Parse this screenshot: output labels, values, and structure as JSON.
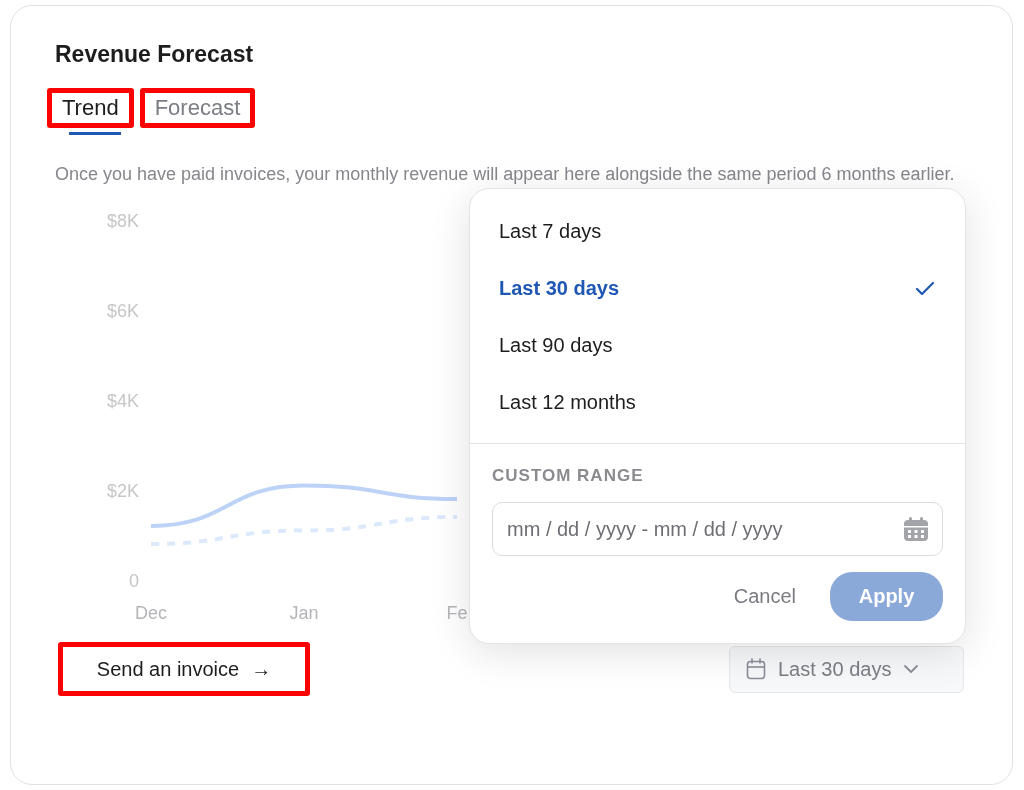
{
  "card": {
    "title": "Revenue Forecast"
  },
  "tabs": [
    {
      "label": "Trend",
      "selected": true,
      "highlighted": true
    },
    {
      "label": "Forecast",
      "selected": false,
      "highlighted": true
    }
  ],
  "description": "Once you have paid invoices, your monthly revenue will appear here alongside the same period 6 months earlier.",
  "chart": {
    "chart_data": {
      "type": "line",
      "categories": [
        "Dec",
        "Jan",
        "Fe"
      ],
      "yticks": [
        {
          "value": 0,
          "label": "0"
        },
        {
          "value": 2000,
          "label": "$2K"
        },
        {
          "value": 4000,
          "label": "$4K"
        },
        {
          "value": 6000,
          "label": "$6K"
        },
        {
          "value": 8000,
          "label": "$8K"
        }
      ],
      "ylim": [
        0,
        8000
      ],
      "series": [
        {
          "color": "#bcd3f7",
          "line_style": "solid",
          "values": [
            1200,
            2100,
            1800
          ]
        },
        {
          "color": "#dce8fb",
          "line_style": "dashed",
          "values": [
            800,
            1100,
            1400
          ]
        }
      ]
    }
  },
  "range_menu": {
    "options": [
      {
        "label": "Last 7 days",
        "selected": false
      },
      {
        "label": "Last 30 days",
        "selected": true
      },
      {
        "label": "Last 90 days",
        "selected": false
      },
      {
        "label": "Last 12 months",
        "selected": false
      }
    ],
    "custom_heading": "CUSTOM RANGE",
    "date_field": {
      "placeholder": "mm / dd / yyyy - mm / dd / yyyy"
    },
    "cancel": "Cancel",
    "apply": {
      "label": "Apply",
      "disabled": true
    }
  },
  "send_button": {
    "label": "Send an invoice",
    "icon": "→",
    "highlighted": true
  },
  "range_button": {
    "label": "Last 30 days"
  }
}
